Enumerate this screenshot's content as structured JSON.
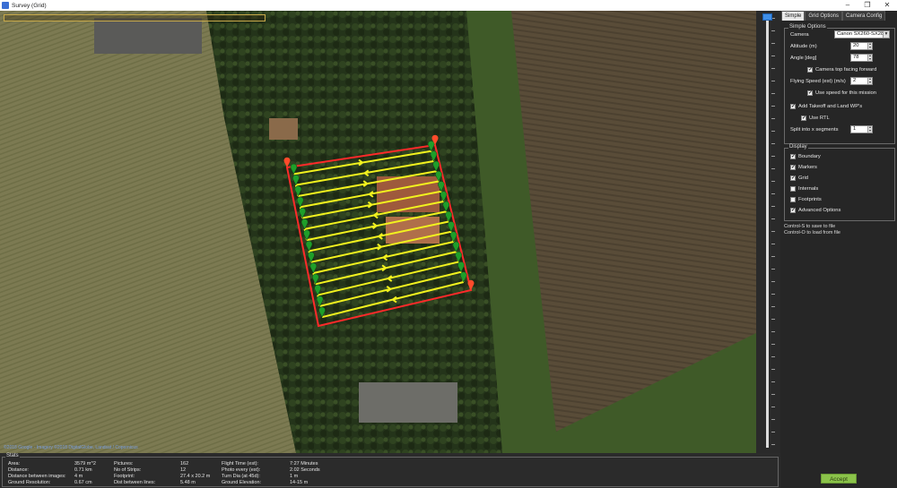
{
  "window": {
    "title": "Survey (Grid)",
    "min": "–",
    "max": "❐",
    "close": "✕"
  },
  "map": {
    "attribution": "©2018 Google - Imagery ©2018 DigitalGlobe, Landsat / Copernicus"
  },
  "tabs": [
    "Simple",
    "Grid Options",
    "Camera Config"
  ],
  "simple_options": {
    "legend": "Simple Options",
    "camera_label": "Camera",
    "camera_value": "Canon SX260-SX280",
    "altitude_label": "Altitude (m)",
    "altitude_value": "20",
    "angle_label": "Angle [deg]",
    "angle_value": "78",
    "camera_top_facing_label": "Camera top facing forward",
    "flying_speed_label": "Flying Speed (est) (m/s)",
    "flying_speed_value": "2",
    "use_speed_label": "Use speed for this mission",
    "takeoff_label": "Add Takeoff and Land WP's",
    "rtl_label": "Use RTL",
    "split_label": "Split into x segments",
    "split_value": "1"
  },
  "display": {
    "legend": "Display",
    "items": [
      {
        "label": "Boundary",
        "checked": true
      },
      {
        "label": "Markers",
        "checked": true
      },
      {
        "label": "Grid",
        "checked": true
      },
      {
        "label": "Internals",
        "checked": false
      },
      {
        "label": "Footprints",
        "checked": false
      },
      {
        "label": "Advanced Options",
        "checked": true
      }
    ]
  },
  "hints": {
    "save": "Control-S to save to file",
    "load": "Control-O to load from file"
  },
  "accept_label": "Accept",
  "stats": {
    "legend": "Stats",
    "col1": [
      {
        "label": "Area:",
        "value": "3579 m^2"
      },
      {
        "label": "Distance:",
        "value": "0.71 km"
      },
      {
        "label": "Distance between images:",
        "value": "4 m"
      },
      {
        "label": "Ground Resolution:",
        "value": "0.67 cm"
      }
    ],
    "col2": [
      {
        "label": "Pictures:",
        "value": "162"
      },
      {
        "label": "No of Strips:",
        "value": "12"
      },
      {
        "label": "Footprint:",
        "value": "27.4 x 20.2 m"
      },
      {
        "label": "Dist between lines:",
        "value": "5.48 m"
      }
    ],
    "col3": [
      {
        "label": "Flight Time (est):",
        "value": "7:27 Minutes"
      },
      {
        "label": "Photo every (est):",
        "value": "2.02 Seconds"
      },
      {
        "label": "Turn Dia (at 45d):",
        "value": "1 m"
      },
      {
        "label": "Ground Elevation:",
        "value": "14-15 m"
      }
    ]
  },
  "colors": {
    "boundary": "#ff2a2a",
    "grid": "#f2f21e",
    "marker": "#1f9e2a",
    "accept": "#8bc34a"
  }
}
